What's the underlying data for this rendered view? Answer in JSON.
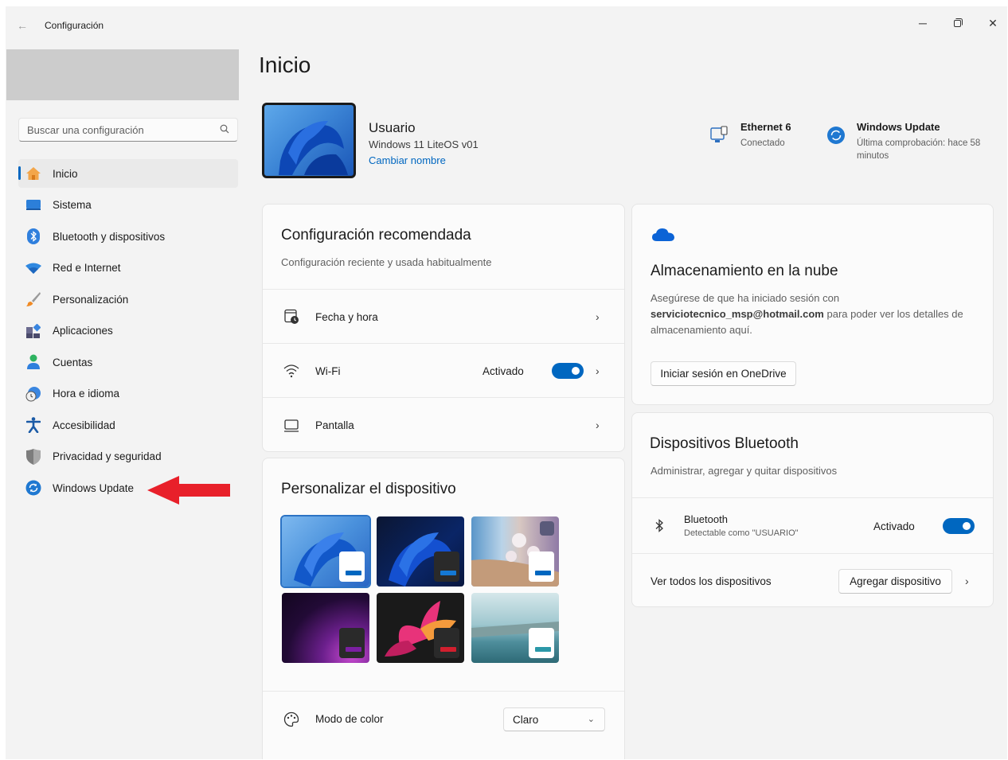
{
  "window": {
    "title": "Configuración"
  },
  "sidebar": {
    "search_placeholder": "Buscar una configuración",
    "items": [
      {
        "label": "Inicio",
        "icon": "home-icon",
        "active": true
      },
      {
        "label": "Sistema",
        "icon": "monitor-icon"
      },
      {
        "label": "Bluetooth y dispositivos",
        "icon": "bluetooth-icon"
      },
      {
        "label": "Red e Internet",
        "icon": "wifi-icon"
      },
      {
        "label": "Personalización",
        "icon": "brush-icon"
      },
      {
        "label": "Aplicaciones",
        "icon": "apps-icon"
      },
      {
        "label": "Cuentas",
        "icon": "person-icon"
      },
      {
        "label": "Hora e idioma",
        "icon": "clock-globe-icon"
      },
      {
        "label": "Accesibilidad",
        "icon": "accessibility-icon"
      },
      {
        "label": "Privacidad y seguridad",
        "icon": "shield-icon"
      },
      {
        "label": "Windows Update",
        "icon": "update-icon"
      }
    ]
  },
  "main": {
    "page_title": "Inicio",
    "user": {
      "name": "Usuario",
      "os": "Windows 11 LiteOS v01",
      "rename_link": "Cambiar nombre"
    },
    "status": {
      "ethernet": {
        "title": "Ethernet 6",
        "sub": "Conectado"
      },
      "update": {
        "title": "Windows Update",
        "sub": "Última comprobación: hace 58 minutos"
      }
    },
    "recommended": {
      "title": "Configuración recomendada",
      "subtitle": "Configuración reciente y usada habitualmente",
      "rows": [
        {
          "label": "Fecha y hora",
          "icon": "calendar-clock-icon"
        },
        {
          "label": "Wi-Fi",
          "icon": "wifi-icon",
          "status": "Activado",
          "toggle": true
        },
        {
          "label": "Pantalla",
          "icon": "display-icon"
        }
      ]
    },
    "personalize": {
      "title": "Personalizar el dispositivo",
      "color_mode_label": "Modo de color",
      "color_mode_value": "Claro"
    },
    "cloud": {
      "title": "Almacenamiento en la nube",
      "body_pre": "Asegúrese de que ha iniciado sesión con",
      "email": "serviciotecnico_msp@hotmail.com",
      "body_post": "para poder ver los detalles de almacenamiento aquí.",
      "button": "Iniciar sesión en OneDrive"
    },
    "bluetooth": {
      "title": "Dispositivos Bluetooth",
      "subtitle": "Administrar, agregar y quitar dispositivos",
      "device_label": "Bluetooth",
      "device_sub": "Detectable como \"USUARIO\"",
      "status": "Activado",
      "view_all": "Ver todos los dispositivos",
      "add_button": "Agregar dispositivo"
    }
  },
  "colors": {
    "accent": "#0067c0",
    "annotation_arrow": "#e8202a"
  }
}
